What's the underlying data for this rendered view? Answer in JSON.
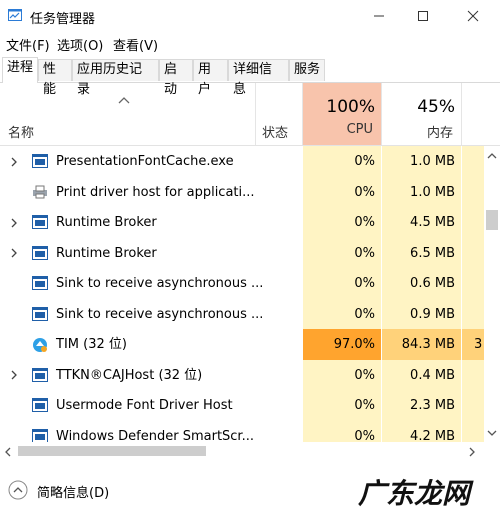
{
  "window": {
    "title": "任务管理器"
  },
  "menu": [
    "文件(F)",
    "选项(O)",
    "查看(V)"
  ],
  "tabs": [
    "进程",
    "性能",
    "应用历史记录",
    "启动",
    "用户",
    "详细信息",
    "服务"
  ],
  "header": {
    "name_label": "名称",
    "status_label": "状态",
    "cpu_pct": "100%",
    "cpu_label": "CPU",
    "mem_pct": "45%",
    "mem_label": "内存"
  },
  "rows": [
    {
      "name": "PresentationFontCache.exe",
      "cpu": "0%",
      "mem": "1.0 MB",
      "expandable": true,
      "icon": "window-icon"
    },
    {
      "name": "Print driver host for applicati...",
      "cpu": "0%",
      "mem": "1.0 MB",
      "expandable": false,
      "icon": "printer-icon"
    },
    {
      "name": "Runtime Broker",
      "cpu": "0%",
      "mem": "4.5 MB",
      "expandable": true,
      "icon": "window-icon"
    },
    {
      "name": "Runtime Broker",
      "cpu": "0%",
      "mem": "6.5 MB",
      "expandable": true,
      "icon": "window-icon"
    },
    {
      "name": "Sink to receive asynchronous ...",
      "cpu": "0%",
      "mem": "0.6 MB",
      "expandable": false,
      "icon": "window-icon"
    },
    {
      "name": "Sink to receive asynchronous ...",
      "cpu": "0%",
      "mem": "0.9 MB",
      "expandable": false,
      "icon": "window-icon"
    },
    {
      "name": "TIM (32 位)",
      "cpu": "97.0%",
      "mem": "84.3 MB",
      "expandable": false,
      "icon": "tim-icon",
      "extra": "3",
      "highlight": true
    },
    {
      "name": "TTKN®CAJHost (32 位)",
      "cpu": "0%",
      "mem": "0.4 MB",
      "expandable": true,
      "icon": "window-icon"
    },
    {
      "name": "Usermode Font Driver Host",
      "cpu": "0%",
      "mem": "2.3 MB",
      "expandable": false,
      "icon": "window-icon"
    },
    {
      "name": "Windows Defender SmartScr...",
      "cpu": "0%",
      "mem": "4.2 MB",
      "expandable": false,
      "icon": "window-icon"
    }
  ],
  "footer": {
    "less_details": "简略信息(D)"
  },
  "watermark": "广东龙网",
  "colors": {
    "cpu_header": "#f8c4ac",
    "cpu_cell": "#fff4c4",
    "mem_cell": "#fff4c4",
    "cpu_hot": "#ffa42e",
    "mem_hot": "#ffd27a"
  }
}
